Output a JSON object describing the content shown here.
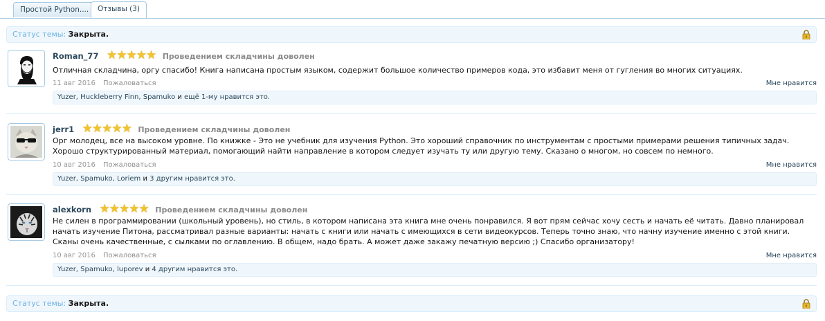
{
  "tabs": [
    {
      "label": "Простой Python...."
    },
    {
      "label": "Отзывы (3)"
    }
  ],
  "status": {
    "label": "Статус темы:",
    "value": "Закрыта."
  },
  "reviews": [
    {
      "author": "Roman_77",
      "rating": 5,
      "rating_title": "Проведением складчины доволен",
      "text": "Отличная складчина, оргу спасибо! Книга написана простым языком, содержит большое количество примеров кода, это избавит меня от гугления во многих ситуациях.",
      "date": "11 авг 2016",
      "report": "Пожаловаться",
      "like": "Мне нравится",
      "likes": {
        "names": "Yuzer, Huckleberry Finn, Spamuko",
        "connector": " и ",
        "more": "ещё 1-му",
        "suffix": " нравится это."
      }
    },
    {
      "author": "jerr1",
      "rating": 5,
      "rating_title": "Проведением складчины доволен",
      "text": "Орг молодец, все на высоком уровне. По книжке - Это не учебник для изучения Python. Это хороший справочник по инструментам с простыми примерами решения типичных задач. Хорошо структурированный материал, помогающий найти направление в котором следует изучать ту или другую тему. Сказано о многом, но совсем по немного.",
      "date": "10 авг 2016",
      "report": "Пожаловаться",
      "like": "Мне нравится",
      "likes": {
        "names": "Yuzer, Spamuko, Loriem",
        "connector": " и ",
        "more": "3 другим",
        "suffix": " нравится это."
      }
    },
    {
      "author": "alexkorn",
      "rating": 5,
      "rating_title": "Проведением складчины доволен",
      "text": "Не силен в программировании (школьный уровень), но стиль, в котором написана эта книга мне очень понравился. Я вот прям сейчас хочу сесть и начать её читать. Давно планировал начать изучение Питона, рассматривал разные варианты: начать с книги или начать с имеющихся в сети видеокурсов. Теперь точно знаю, что начну изучение именно с этой книги. Сканы очень качественные, с сылками по оглавлению. В общем, надо брать. А может даже закажу печатную версию ;) Спасибо организатору!",
      "date": "10 авг 2016",
      "report": "Пожаловаться",
      "like": "Мне нравится",
      "likes": {
        "names": "Yuzer, Spamuko, luporev",
        "connector": " и ",
        "more": "4 другим",
        "suffix": " нравится это."
      }
    }
  ],
  "colors": {
    "accent": "#2b485c",
    "star": "#f2c32b",
    "status_bg": "#f0f7fc",
    "border": "#a5cae4"
  }
}
